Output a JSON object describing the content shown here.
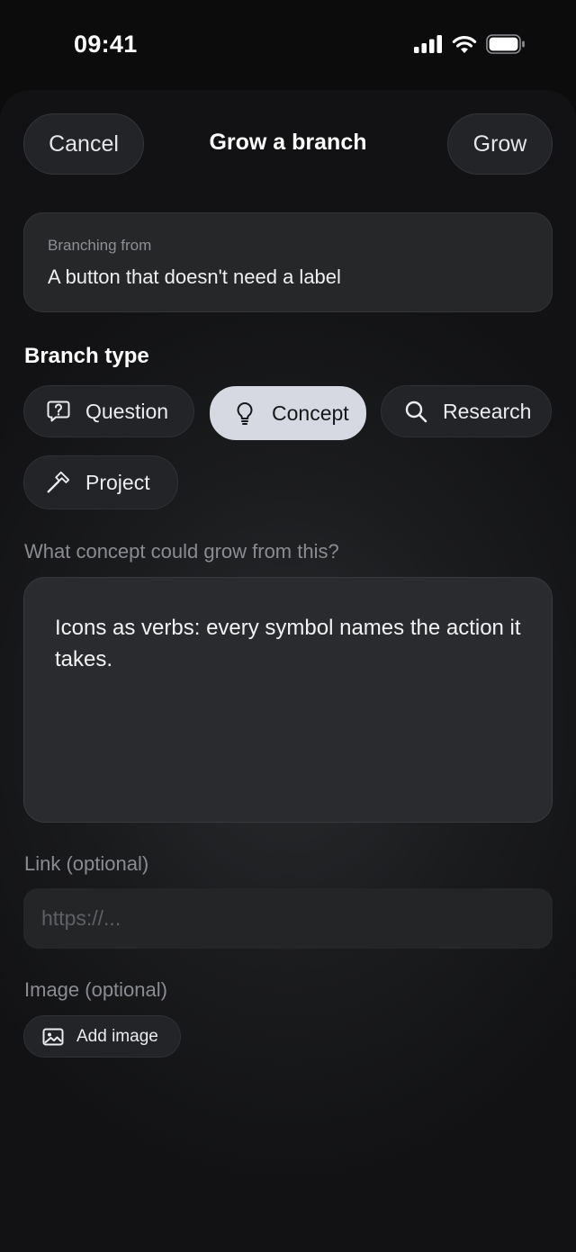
{
  "status_bar": {
    "time": "09:41",
    "icons": [
      "cellular-signal-icon",
      "wifi-icon",
      "battery-icon"
    ]
  },
  "nav": {
    "cancel_label": "Cancel",
    "title": "Grow a branch",
    "grow_label": "Grow"
  },
  "source": {
    "caption": "Branching from",
    "text": "A button that doesn't need a label"
  },
  "branch_type": {
    "title": "Branch type",
    "selected": "Concept",
    "options": [
      {
        "label": "Question",
        "icon": "question-bubble-icon"
      },
      {
        "label": "Concept",
        "icon": "lightbulb-icon"
      },
      {
        "label": "Research",
        "icon": "search-icon"
      },
      {
        "label": "Project",
        "icon": "hammer-icon"
      }
    ]
  },
  "concept_field": {
    "label": "What concept could grow from this?",
    "value": "Icons as verbs: every symbol names the action it takes."
  },
  "link_field": {
    "label": "Link (optional)",
    "placeholder": "https://...",
    "value": ""
  },
  "image_field": {
    "label": "Image (optional)",
    "button_label": "Add image",
    "icon": "image-icon"
  },
  "colors": {
    "background": "#0c0c0d",
    "sheet": "#1a1b1d",
    "chip": "#232427",
    "chip_selected": "#d6d8e2",
    "muted_text": "#8b8c92"
  }
}
